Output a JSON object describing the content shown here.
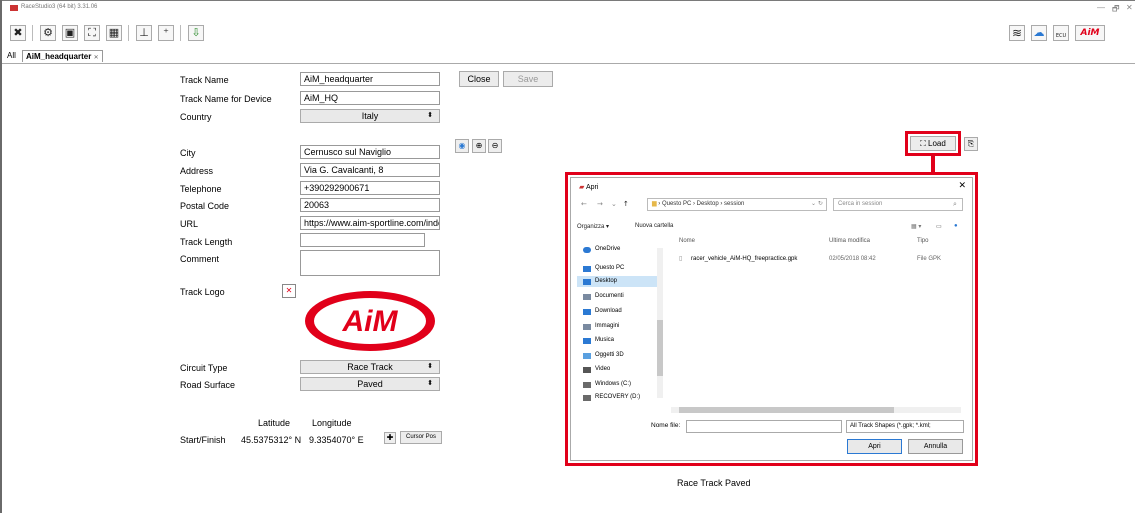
{
  "window": {
    "title": "RaceStudio3 (64 bit) 3.31.06",
    "controls": [
      "—",
      "🗗",
      "✕"
    ]
  },
  "toolbar": {
    "buttons": [
      {
        "icon": "tools-icon",
        "glyph": "✖"
      },
      {
        "icon": "gear-icon",
        "glyph": "⚙"
      },
      {
        "icon": "dash-icon",
        "glyph": "▣"
      },
      {
        "icon": "track-icon",
        "glyph": "⛶"
      },
      {
        "icon": "device-icon",
        "glyph": "▦"
      },
      {
        "icon": "analysis-icon",
        "glyph": "⊥"
      },
      {
        "icon": "math-icon",
        "glyph": "⁺"
      },
      {
        "icon": "download-icon",
        "glyph": "⇩"
      }
    ],
    "right_icons": [
      "wifi-icon",
      "cloud-icon",
      "ecu-icon",
      "aim-logo-icon"
    ],
    "ecu_label": "ECU",
    "aim_label": "AiM"
  },
  "tabs": {
    "all_label": "All",
    "active_label": "AiM_headquarter",
    "close_glyph": "✕"
  },
  "form": {
    "track_name_label": "Track Name",
    "track_name_value": "AiM_headquarter",
    "close_label": "Close",
    "save_label": "Save",
    "track_name_device_label": "Track Name for Device",
    "track_name_device_value": "AiM_HQ",
    "country_label": "Country",
    "country_value": "Italy",
    "city_label": "City",
    "city_value": "Cernusco sul Naviglio",
    "address_label": "Address",
    "address_value": "Via G. Cavalcanti, 8",
    "telephone_label": "Telephone",
    "telephone_value": "+390292900671",
    "postal_code_label": "Postal Code",
    "postal_code_value": "20063",
    "url_label": "URL",
    "url_value": "https://www.aim-sportline.com/index",
    "track_length_label": "Track Length",
    "track_length_value": "",
    "comment_label": "Comment",
    "comment_value": "",
    "track_logo_label": "Track Logo",
    "logo_text": "AiM",
    "circuit_type_label": "Circuit Type",
    "circuit_type_value": "Race Track",
    "road_surface_label": "Road Surface",
    "road_surface_value": "Paved",
    "latitude_label": "Latitude",
    "longitude_label": "Longitude",
    "start_finish_label": "Start/Finish",
    "start_finish_lat": "45.5375312° N",
    "start_finish_lon": "9.3354070° E",
    "cursor_pos_label": "Cursor Pos"
  },
  "map": {
    "load_label": "Load",
    "footer_text": "Race Track  Paved"
  },
  "dialog": {
    "title": "Apri",
    "breadcrumb": "› Questo PC › Desktop › session",
    "search_placeholder": "Cerca in session",
    "organize_label": "Organizza ▾",
    "new_folder_label": "Nuova cartella",
    "columns": {
      "name": "Nome",
      "modified": "Ultima modifica",
      "type": "Tipo"
    },
    "nav_items": [
      {
        "label": "OneDrive",
        "icon": "cloud-icon",
        "color": "#2b79d3"
      },
      {
        "label": "Questo PC",
        "icon": "pc-icon",
        "color": "#2b79d3"
      },
      {
        "label": "Desktop",
        "icon": "desktop-icon",
        "color": "#2b79d3"
      },
      {
        "label": "Documenti",
        "icon": "documents-icon",
        "color": "#7a8aa0"
      },
      {
        "label": "Download",
        "icon": "download-icon",
        "color": "#2b79d3"
      },
      {
        "label": "Immagini",
        "icon": "images-icon",
        "color": "#7a8aa0"
      },
      {
        "label": "Musica",
        "icon": "music-icon",
        "color": "#2b79d3"
      },
      {
        "label": "Oggetti 3D",
        "icon": "objects-3d-icon",
        "color": "#5aa0e0"
      },
      {
        "label": "Video",
        "icon": "video-icon",
        "color": "#555555"
      },
      {
        "label": "Windows (C:)",
        "icon": "drive-icon",
        "color": "#6a6a6a"
      },
      {
        "label": "RECOVERY (D:)",
        "icon": "drive-icon",
        "color": "#6a6a6a"
      }
    ],
    "files": [
      {
        "name": "racer_vehicle_AiM-HQ_freepractice.gpk",
        "modified": "02/05/2018 08:42",
        "type": "File GPK"
      }
    ],
    "filename_label": "Nome file:",
    "filename_value": "",
    "filter_value": "All Track Shapes (*.gpk; *.kml;",
    "open_label": "Apri",
    "cancel_label": "Annulla"
  },
  "colors": {
    "highlight": "#e1001a",
    "aim_red": "#e1001a",
    "selection": "#cce4f7"
  }
}
